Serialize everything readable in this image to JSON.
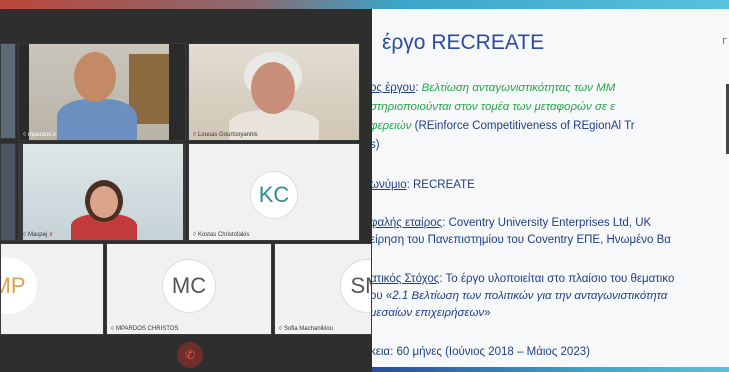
{
  "call": {
    "tiles": [
      {
        "name": "mpardos.v",
        "initials": ""
      },
      {
        "name": "Loucas Gourtsoyannis",
        "initials": ""
      },
      {
        "name": "Maspej",
        "initials": ""
      },
      {
        "name": "Kostas Christofakis",
        "initials": "KC"
      },
      {
        "name": "",
        "initials": "MP"
      },
      {
        "name": "MPARDOS CHRISTOS",
        "initials": "MC"
      },
      {
        "name": "Sofia Machaniklou",
        "initials": "SM"
      }
    ],
    "colors": {
      "avatar_kc": "#2e8b9a",
      "avatar_mp": "#e0a24a",
      "avatar_mc": "#555555",
      "avatar_sm": "#555555"
    }
  },
  "slide": {
    "title": "έργο RECREATE",
    "right_mark": "Γ",
    "line1_label": "ος έργου",
    "line1_colon": ": ",
    "line1_green": "Βελτίωση ανταγωνιστικότητας των ΜΜ",
    "line2_green": "στηριοποιούνται στον τομέα των μεταφορών σε ε",
    "line3_green": "φερειών",
    "line3_rest": " (REinforce Competitiveness of REgionAl Tr",
    "line4": "s)",
    "line5_label": "ωνύμιο",
    "line5_rest": ": RECREATE",
    "line6_label": "φαλής εταίρος",
    "line6_rest": ": Coventry University Enterprises Ltd, UK",
    "line7": "είρηση του Πανεπιστημίου του Coventry ΕΠΕ, Ηνωμένο Βα",
    "line8_label": "ατικός Στόχος",
    "line8_rest": ": Το έργο υλοποιείται στο πλαίσιο του θεματικο",
    "line9_pre": "ου «",
    "line9_it": "2.1 Βελτίωση των πολιτικών για την ανταγωνιστικότητα",
    "line10_it": "μεσαίων επιχειρήσεων",
    "line10_end": "»",
    "line11": "κεια: 60 μήνες (Ιούνιος 2018 – Μάιος 2023)"
  }
}
